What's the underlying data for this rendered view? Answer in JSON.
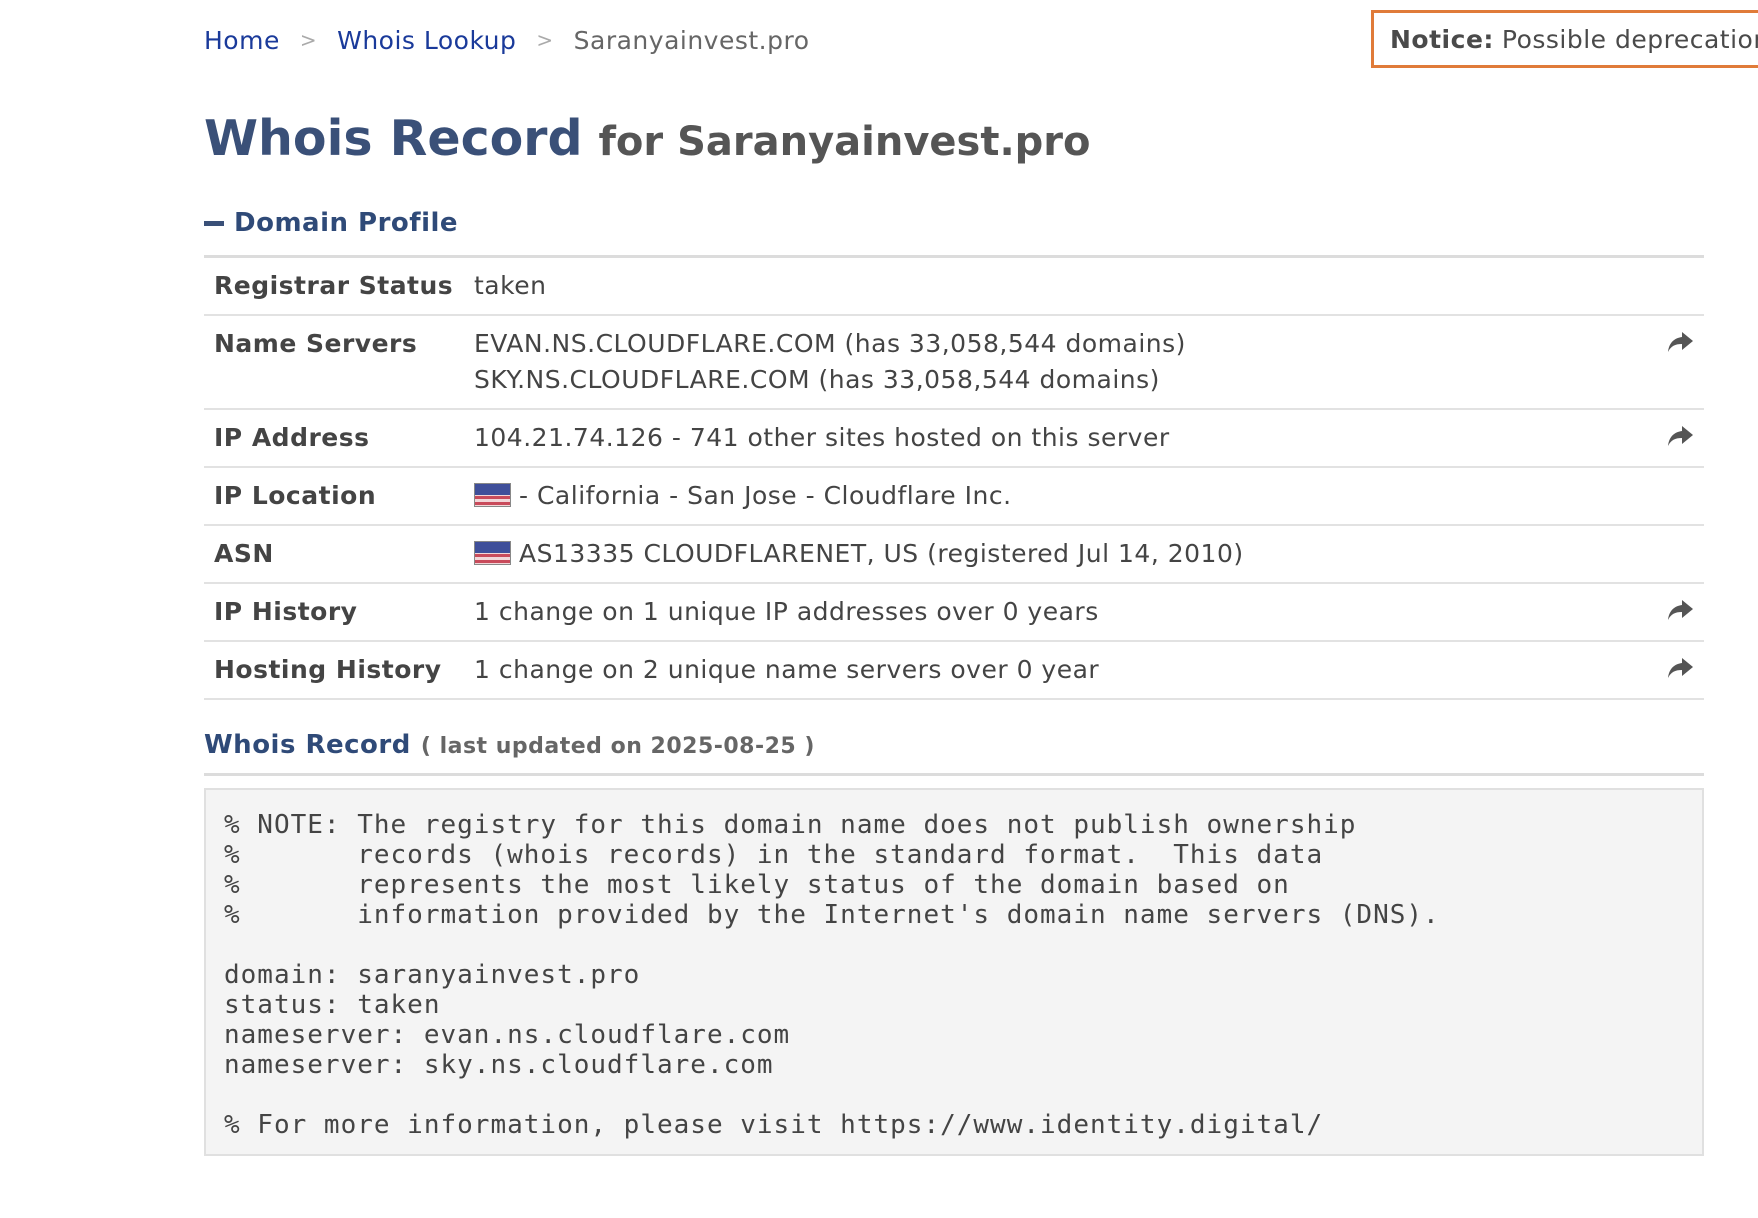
{
  "breadcrumb": {
    "home": "Home",
    "sep1": ">",
    "whois_lookup": "Whois Lookup",
    "sep2": ">",
    "current": "Saranyainvest.pro"
  },
  "notice": {
    "label": "Notice:",
    "text": "Possible deprecation"
  },
  "title": {
    "main": "Whois Record",
    "sub": "for Saranyainvest.pro"
  },
  "domain_profile": {
    "heading": "Domain Profile",
    "rows": [
      {
        "key": "Registrar Status",
        "values": [
          "taken"
        ]
      },
      {
        "key": "Name Servers",
        "values": [
          "EVAN.NS.CLOUDFLARE.COM (has 33,058,544 domains)",
          "SKY.NS.CLOUDFLARE.COM (has 33,058,544 domains)"
        ]
      },
      {
        "key": "IP Address",
        "values": [
          "104.21.74.126 - 741 other sites hosted on this server"
        ]
      },
      {
        "key": "IP Location",
        "values": [
          "- California - San Jose - Cloudflare Inc."
        ]
      },
      {
        "key": "ASN",
        "values": [
          "AS13335 CLOUDFLARENET, US (registered Jul 14, 2010)"
        ]
      },
      {
        "key": "IP History",
        "values": [
          "1 change on 1 unique IP addresses over 0 years"
        ]
      },
      {
        "key": "Hosting History",
        "values": [
          "1 change on 2 unique name servers over 0 year"
        ]
      }
    ]
  },
  "whois_record": {
    "heading": "Whois Record",
    "updated": "( last updated on 2025-08-25 )",
    "raw": "% NOTE: The registry for this domain name does not publish ownership\n%       records (whois records) in the standard format.  This data\n%       represents the most likely status of the domain based on\n%       information provided by the Internet's domain name servers (DNS).\n\ndomain: saranyainvest.pro\nstatus: taken\nnameserver: evan.ns.cloudflare.com\nnameserver: sky.ns.cloudflare.com\n\n% For more information, please visit https://www.identity.digital/"
  },
  "icons": {
    "share": "share-arrow-icon",
    "flag": "us-flag-icon",
    "collapse": "minus-icon"
  },
  "colors": {
    "link": "#1a3a9a",
    "heading": "#3a5078",
    "notice_border": "#e07b39"
  }
}
